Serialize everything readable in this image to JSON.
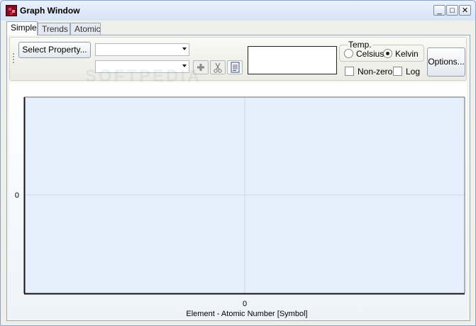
{
  "window": {
    "title": "Graph Window"
  },
  "window_controls": {
    "minimize": "_",
    "maximize": "□",
    "close": "✕"
  },
  "tabs": [
    {
      "label": "Simple",
      "active": true
    },
    {
      "label": "Trends",
      "active": false
    },
    {
      "label": "Atomic",
      "active": false
    }
  ],
  "toolbar": {
    "select_property_label": "Select Property...",
    "combo1_value": "",
    "combo2_value": "",
    "icons": [
      "plus-icon",
      "scissors-icon",
      "document-icon"
    ],
    "temp_group_label": "Temp.",
    "celsius_label": "Celsius",
    "kelvin_label": "Kelvin",
    "selected_unit": "Kelvin",
    "nonzero_label": "Non-zero",
    "nonzero_checked": false,
    "log_label": "Log",
    "log_checked": false,
    "options_label": "Options..."
  },
  "watermark": "SOFTPEDIA",
  "chart_data": {
    "type": "line",
    "xlabel": "Element - Atomic Number [Symbol]",
    "ylabel": "",
    "x_ticks": [
      "0"
    ],
    "y_ticks": [
      "0"
    ],
    "series": [],
    "grid": true
  }
}
